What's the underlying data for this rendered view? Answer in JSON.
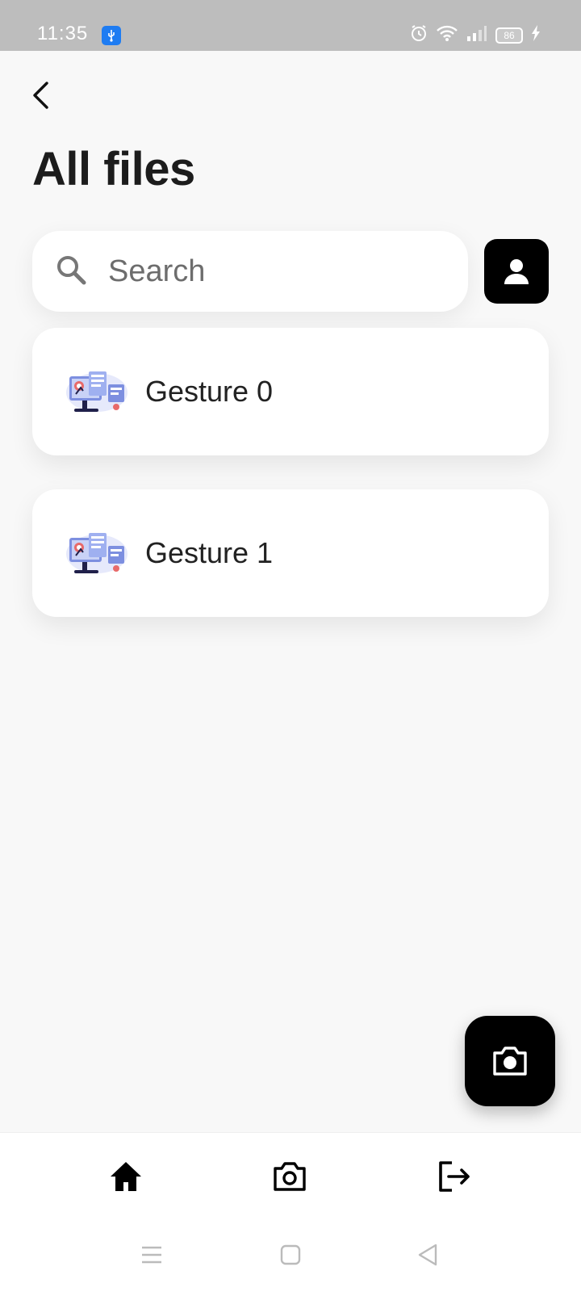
{
  "status_bar": {
    "time": "11:35",
    "battery_level": "86",
    "icons": [
      "usb-icon",
      "alarm-icon",
      "wifi-icon",
      "signal-icon",
      "battery-icon",
      "charging-icon"
    ]
  },
  "header": {
    "title": "All files",
    "back_icon": "chevron-left-icon"
  },
  "search": {
    "placeholder": "Search",
    "value": ""
  },
  "files": [
    {
      "name": "Gesture 0",
      "thumbnail": "gesture-illustration"
    },
    {
      "name": "Gesture 1",
      "thumbnail": "gesture-illustration"
    }
  ],
  "fab": {
    "icon": "camera-icon"
  },
  "bottom_nav": {
    "items": [
      {
        "icon": "home-icon",
        "active": true
      },
      {
        "icon": "camera-icon",
        "active": false
      },
      {
        "icon": "logout-icon",
        "active": false
      }
    ]
  },
  "system_nav": {
    "icons": [
      "menu-icon",
      "square-home-icon",
      "triangle-back-icon"
    ]
  },
  "colors": {
    "background": "#f8f8f8",
    "status_bar": "#bdbdbd",
    "accent_black": "#000000",
    "card": "#ffffff",
    "usb_badge": "#1e7cf2"
  }
}
